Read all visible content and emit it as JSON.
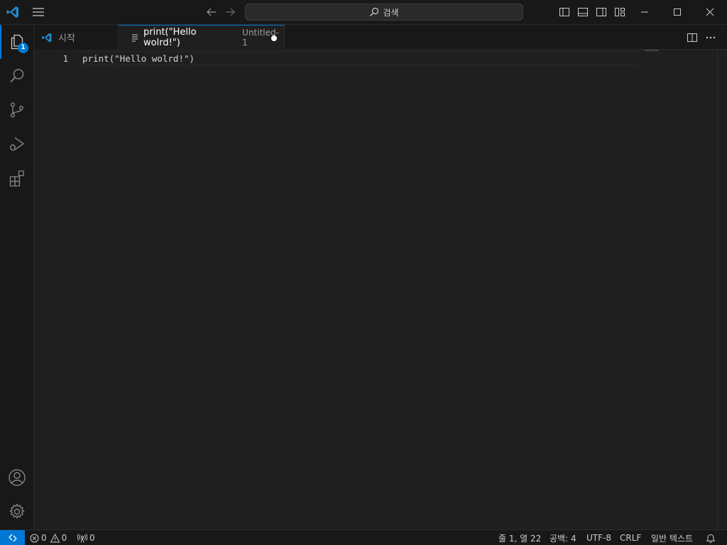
{
  "titlebar": {
    "search_placeholder": "검색"
  },
  "activitybar": {
    "explorer_badge": "1",
    "items": [
      "explorer",
      "search",
      "source-control",
      "run-and-debug",
      "extensions"
    ],
    "bottom_items": [
      "accounts",
      "manage"
    ]
  },
  "tabs": [
    {
      "label": "시작",
      "icon": "vscode-logo-icon"
    },
    {
      "label": "print(\"Hello wolrd!\")",
      "description": "Untitled-1",
      "icon": "text-file-icon",
      "dirty": true
    }
  ],
  "editor": {
    "lines": [
      {
        "number": "1",
        "text": "print(\"Hello wolrd!\")"
      }
    ]
  },
  "statusbar": {
    "errors": "0",
    "warnings": "0",
    "ports": "0",
    "cursor_position": "줄 1, 열 22",
    "indentation": "공백: 4",
    "encoding": "UTF-8",
    "eol": "CRLF",
    "language": "일반 텍스트"
  },
  "colors": {
    "accent": "#0078d4",
    "background": "#1f1f1f",
    "chrome": "#181818"
  }
}
